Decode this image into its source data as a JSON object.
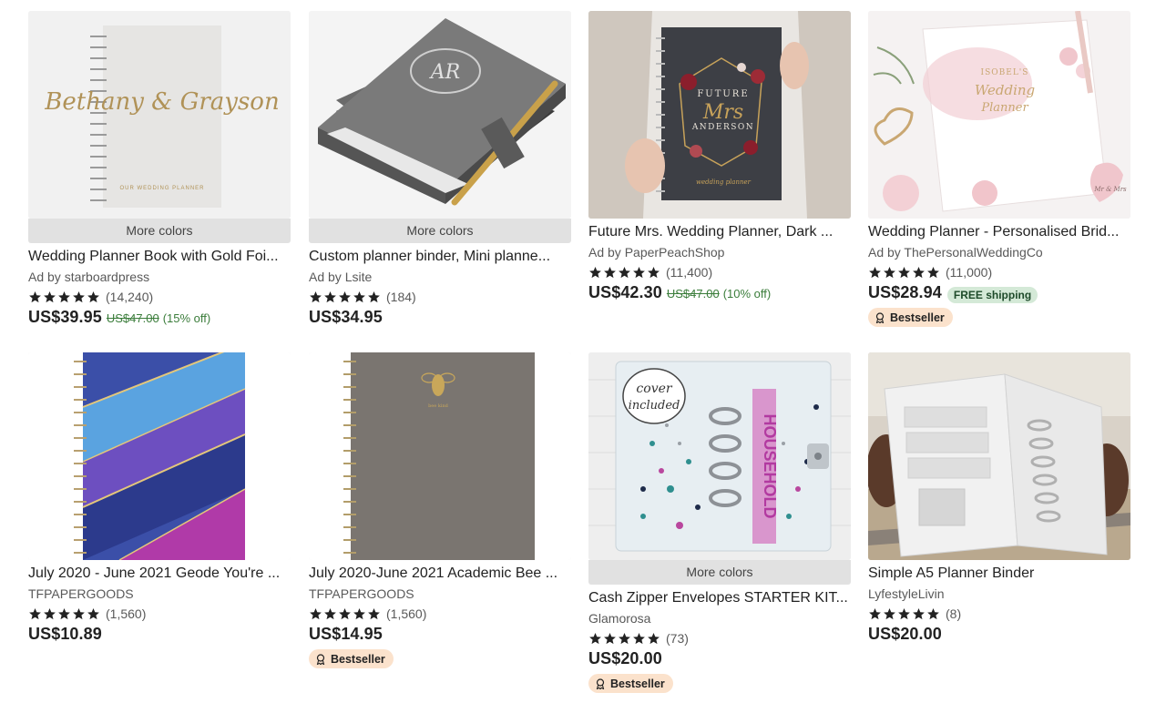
{
  "listings": [
    {
      "title": "Wedding Planner Book with Gold Foi...",
      "shop": "Ad by starboardpress",
      "rating_count": "(14,240)",
      "price": "US$39.95",
      "original_price": "US$47.00",
      "discount": "(15% off)",
      "more_colors": "More colors",
      "cover_text": "Bethany & Grayson",
      "cover_subtext": "OUR WEDDING PLANNER"
    },
    {
      "title": "Custom planner binder, Mini planne...",
      "shop": "Ad by Lsite",
      "rating_count": "(184)",
      "price": "US$34.95",
      "more_colors": "More colors",
      "cover_text": "AR"
    },
    {
      "title": "Future Mrs. Wedding Planner, Dark ...",
      "shop": "Ad by PaperPeachShop",
      "rating_count": "(11,400)",
      "price": "US$42.30",
      "original_price": "US$47.00",
      "discount": "(10% off)",
      "cover_text_1": "FUTURE",
      "cover_text_2": "Mrs",
      "cover_text_3": "ANDERSON",
      "cover_text_4": "wedding planner"
    },
    {
      "title": "Wedding Planner - Personalised Brid...",
      "shop": "Ad by ThePersonalWeddingCo",
      "rating_count": "(11,000)",
      "price": "US$28.94",
      "free_shipping": "FREE shipping",
      "badge": "Bestseller",
      "cover_text_1": "ISOBEL'S",
      "cover_text_2": "Wedding",
      "cover_text_3": "Planner",
      "cover_text_4": "Mr & Mrs"
    },
    {
      "title": "July 2020 - June 2021 Geode You're ...",
      "shop": "TFPAPERGOODS",
      "rating_count": "(1,560)",
      "price": "US$10.89"
    },
    {
      "title": "July 2020-June 2021 Academic Bee ...",
      "shop": "TFPAPERGOODS",
      "rating_count": "(1,560)",
      "price": "US$14.95",
      "badge": "Bestseller",
      "cover_text": "bee kind"
    },
    {
      "title": "Cash Zipper Envelopes STARTER KIT...",
      "shop": "Glamorosa",
      "rating_count": "(73)",
      "price": "US$20.00",
      "more_colors": "More colors",
      "badge": "Bestseller",
      "sticker_text_1": "cover",
      "sticker_text_2": "included",
      "tab_text": "HOUSEHOLD"
    },
    {
      "title": "Simple A5 Planner Binder",
      "shop": "LyfestyleLivin",
      "rating_count": "(8)",
      "price": "US$20.00"
    }
  ],
  "colors": {
    "star": "#222222",
    "discount_green": "#3b7d3b",
    "free_shipping_bg": "#d4e9d7",
    "bestseller_bg": "#fbe2cc",
    "more_colors_bg": "#e1e1e1"
  },
  "icons": {
    "rating": "star-icon",
    "badge": "award-ribbon-icon"
  }
}
